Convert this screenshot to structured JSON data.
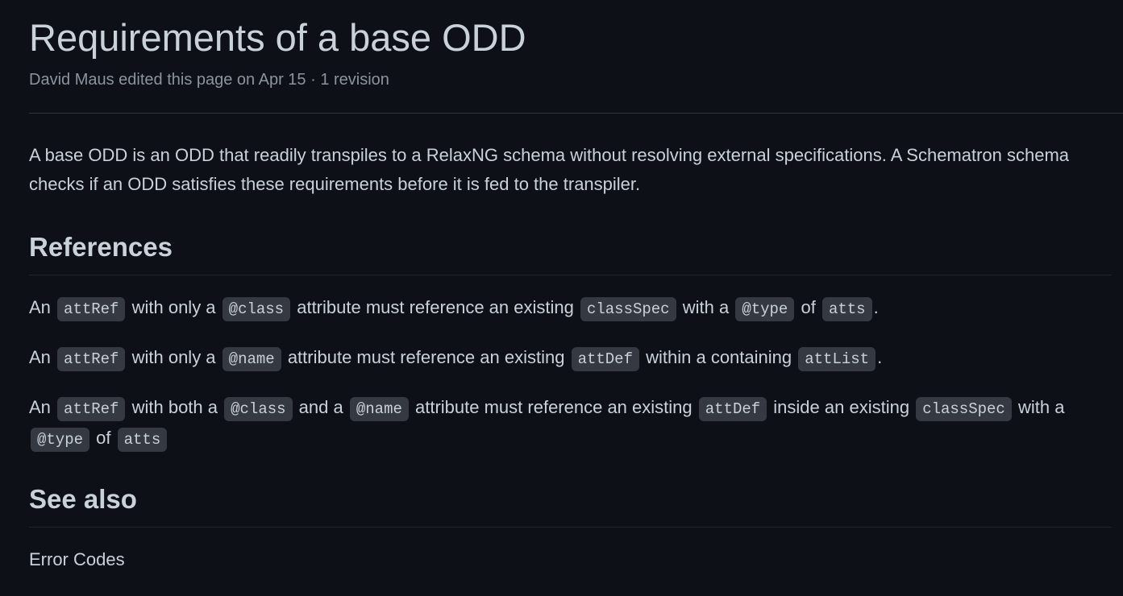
{
  "page": {
    "title": "Requirements of a base ODD",
    "meta": "David Maus edited this page on Apr 15 · 1 revision",
    "intro": "A base ODD is an ODD that readily transpiles to a RelaxNG schema without resolving external specifications. A Schematron schema checks if an ODD satisfies these requirements before it is fed to the transpiler."
  },
  "references": {
    "heading": "References",
    "p1": {
      "t1": "An",
      "c1": "attRef",
      "t2": "with only a",
      "c2": "@class",
      "t3": "attribute must reference an existing",
      "c3": "classSpec",
      "t4": "with a",
      "c4": "@type",
      "t5": "of",
      "c5": "atts",
      "t6": "."
    },
    "p2": {
      "t1": "An",
      "c1": "attRef",
      "t2": "with only a",
      "c2": "@name",
      "t3": "attribute must reference an existing",
      "c3": "attDef",
      "t4": "within a containing",
      "c4": "attList",
      "t5": "."
    },
    "p3": {
      "t1": "An",
      "c1": "attRef",
      "t2": "with both a",
      "c2": "@class",
      "t3": "and a",
      "c3": "@name",
      "t4": "attribute must reference an existing",
      "c4": "attDef",
      "t5": "inside an existing",
      "c5": "classSpec",
      "t6": "with a",
      "c6": "@type",
      "t7": "of",
      "c7": "atts"
    }
  },
  "see_also": {
    "heading": "See also",
    "link": "Error Codes"
  }
}
